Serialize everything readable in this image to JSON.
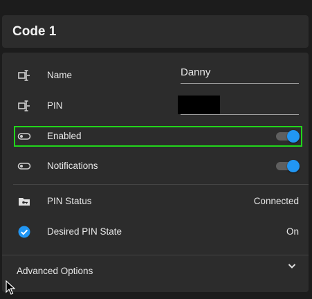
{
  "header": {
    "title": "Code 1"
  },
  "rows": {
    "name": {
      "label": "Name",
      "value": "Danny",
      "icon": "text-box-icon"
    },
    "pin": {
      "label": "PIN",
      "value": "",
      "icon": "text-box-icon"
    },
    "enabled": {
      "label": "Enabled",
      "on": true,
      "icon": "toggle-icon"
    },
    "notifications": {
      "label": "Notifications",
      "on": true,
      "icon": "toggle-icon"
    },
    "pin_status": {
      "label": "PIN Status",
      "value": "Connected",
      "icon": "folder-key-icon"
    },
    "desired_state": {
      "label": "Desired PIN State",
      "value": "On",
      "icon": "check-circle-icon"
    }
  },
  "advanced": {
    "label": "Advanced Options"
  },
  "colors": {
    "accent": "#2196f3",
    "highlight": "#22d61b",
    "card": "#2c2c2c",
    "background": "#1c1c1c"
  }
}
